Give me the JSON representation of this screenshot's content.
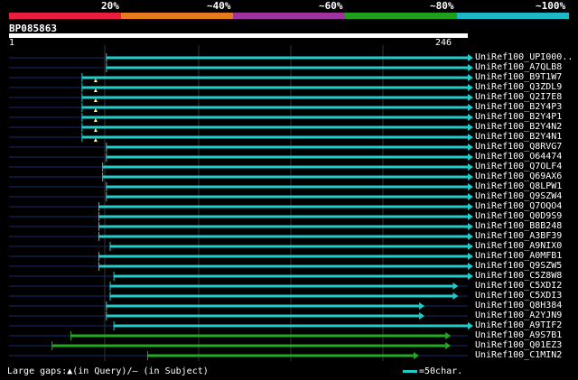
{
  "legend": {
    "labels": [
      "20%",
      "~40%",
      "~60%",
      "~80%",
      "~100%"
    ],
    "colors": [
      "#e81e3c",
      "#e87a1e",
      "#a0349e",
      "#1ea01e",
      "#1eb8c4"
    ]
  },
  "query": {
    "name": "BP085863",
    "start": "1",
    "end": "246"
  },
  "colors": {
    "cyan": "#22cccc",
    "green": "#22aa22",
    "navy": "#1a2a6e",
    "gap": "#ffff88"
  },
  "hits": [
    {
      "label": "UniRef100_UPI000..",
      "start": 53,
      "end": 246,
      "color": "cyan",
      "gap": false
    },
    {
      "label": "UniRef100_A7QLB8",
      "start": 53,
      "end": 246,
      "color": "cyan",
      "gap": false
    },
    {
      "label": "UniRef100_B9T1W7",
      "start": 40,
      "end": 246,
      "color": "cyan",
      "gap": true
    },
    {
      "label": "UniRef100_Q3ZDL9",
      "start": 40,
      "end": 246,
      "color": "cyan",
      "gap": true
    },
    {
      "label": "UniRef100_Q2I7E8",
      "start": 40,
      "end": 246,
      "color": "cyan",
      "gap": true
    },
    {
      "label": "UniRef100_B2Y4P3",
      "start": 40,
      "end": 246,
      "color": "cyan",
      "gap": true
    },
    {
      "label": "UniRef100_B2Y4P1",
      "start": 40,
      "end": 246,
      "color": "cyan",
      "gap": true
    },
    {
      "label": "UniRef100_B2Y4N2",
      "start": 40,
      "end": 246,
      "color": "cyan",
      "gap": true
    },
    {
      "label": "UniRef100_B2Y4N1",
      "start": 40,
      "end": 246,
      "color": "cyan",
      "gap": true
    },
    {
      "label": "UniRef100_Q8RVG7",
      "start": 53,
      "end": 246,
      "color": "cyan",
      "gap": false
    },
    {
      "label": "UniRef100_O64474",
      "start": 53,
      "end": 246,
      "color": "cyan",
      "gap": false
    },
    {
      "label": "UniRef100_Q7OLF4",
      "start": 51,
      "end": 246,
      "color": "cyan",
      "gap": false
    },
    {
      "label": "UniRef100_Q69AX6",
      "start": 51,
      "end": 246,
      "color": "cyan",
      "gap": false
    },
    {
      "label": "UniRef100_Q8LPW1",
      "start": 53,
      "end": 246,
      "color": "cyan",
      "gap": false
    },
    {
      "label": "UniRef100_Q9SZW4",
      "start": 53,
      "end": 246,
      "color": "cyan",
      "gap": false
    },
    {
      "label": "UniRef100_Q7OQO4",
      "start": 49,
      "end": 246,
      "color": "cyan",
      "gap": false
    },
    {
      "label": "UniRef100_Q0D9S9",
      "start": 49,
      "end": 246,
      "color": "cyan",
      "gap": false
    },
    {
      "label": "UniRef100_B8B248",
      "start": 49,
      "end": 246,
      "color": "cyan",
      "gap": false
    },
    {
      "label": "UniRef100_A3BF39",
      "start": 49,
      "end": 246,
      "color": "cyan",
      "gap": false
    },
    {
      "label": "UniRef100_A9NIX0",
      "start": 55,
      "end": 246,
      "color": "cyan",
      "gap": false
    },
    {
      "label": "UniRef100_A0MFB1",
      "start": 49,
      "end": 246,
      "color": "cyan",
      "gap": false
    },
    {
      "label": "UniRef100_Q9SZW5",
      "start": 49,
      "end": 246,
      "color": "cyan",
      "gap": false
    },
    {
      "label": "UniRef100_C5Z8W8",
      "start": 57,
      "end": 246,
      "color": "cyan",
      "gap": false
    },
    {
      "label": "UniRef100_C5XDI2",
      "start": 55,
      "end": 238,
      "color": "cyan",
      "gap": false
    },
    {
      "label": "UniRef100_C5XDI3",
      "start": 55,
      "end": 238,
      "color": "cyan",
      "gap": false
    },
    {
      "label": "UniRef100_Q8H384",
      "start": 53,
      "end": 220,
      "color": "cyan",
      "gap": false
    },
    {
      "label": "UniRef100_A2YJN9",
      "start": 53,
      "end": 220,
      "color": "cyan",
      "gap": false
    },
    {
      "label": "UniRef100_A9TIF2",
      "start": 57,
      "end": 246,
      "color": "cyan",
      "gap": false
    },
    {
      "label": "UniRef100_A9S7B1",
      "start": 34,
      "end": 234,
      "color": "green",
      "gap": false
    },
    {
      "label": "UniRef100_Q01EZ3",
      "start": 24,
      "end": 234,
      "color": "green",
      "gap": false
    },
    {
      "label": "UniRef100_C1MIN2",
      "start": 75,
      "end": 217,
      "color": "green",
      "gap": false
    }
  ],
  "footer": {
    "text": "Large gaps:▲(in Query)/– (in Subject)",
    "scale": "=50char."
  }
}
